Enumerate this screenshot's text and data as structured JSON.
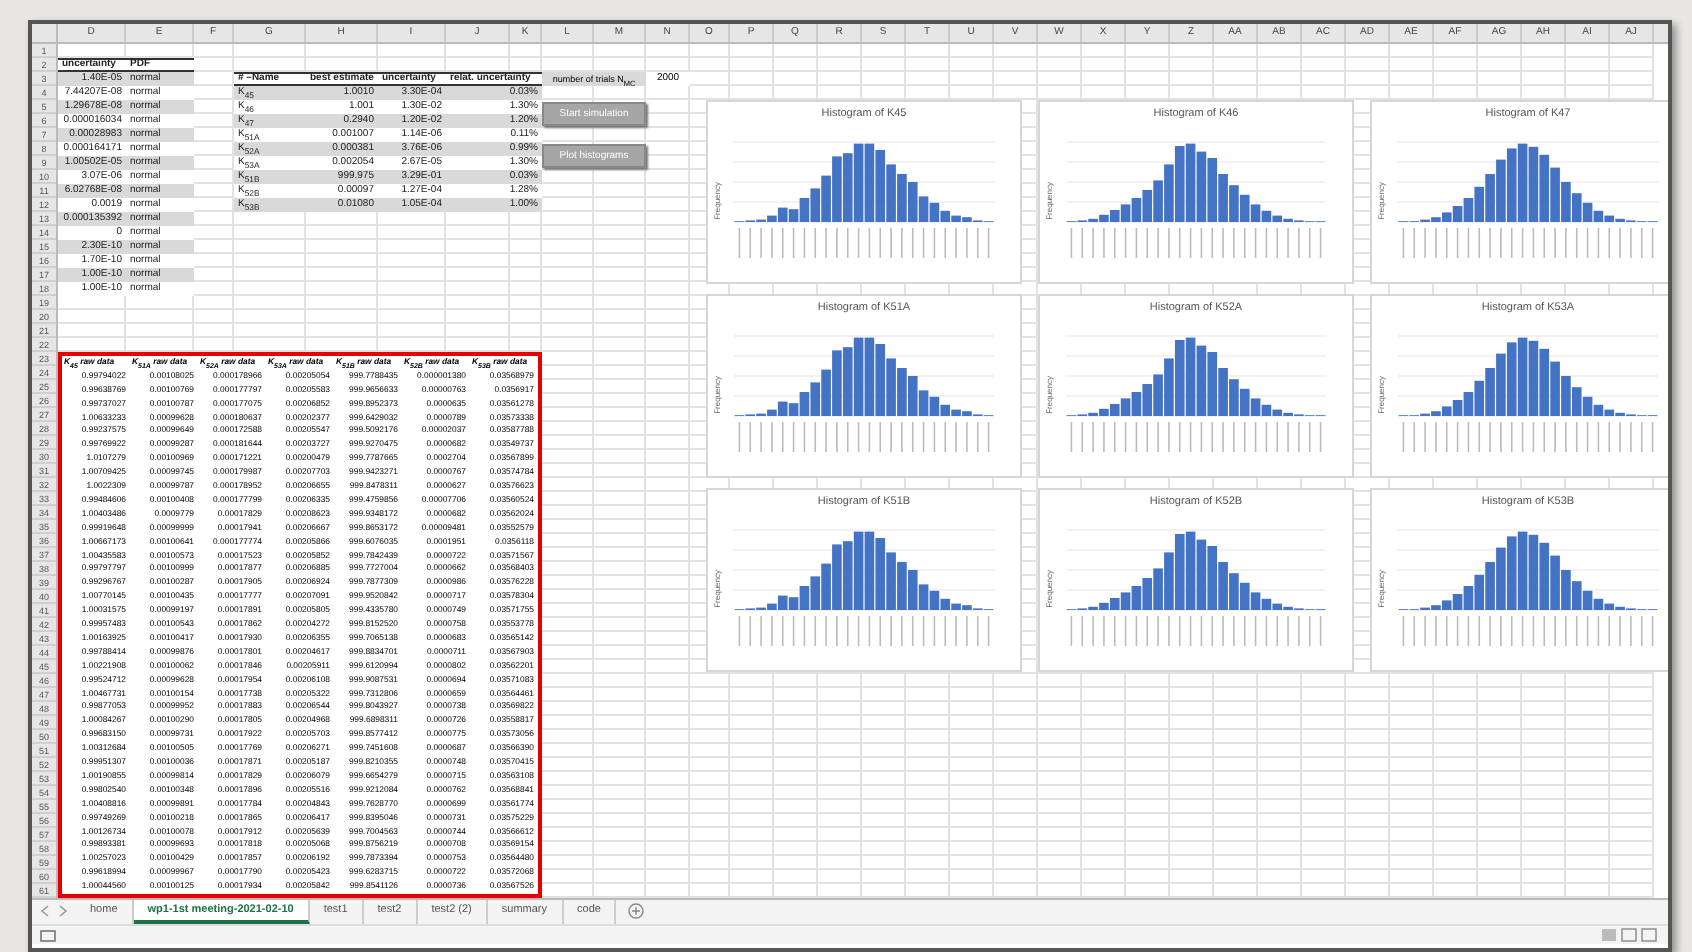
{
  "columns": [
    "D",
    "E",
    "F",
    "G",
    "H",
    "I",
    "J",
    "K",
    "L",
    "M",
    "N",
    "O",
    "P",
    "Q",
    "R",
    "S",
    "T",
    "U",
    "V",
    "W",
    "X",
    "Y",
    "Z",
    "AA",
    "AB",
    "AC",
    "AD",
    "AE",
    "AF",
    "AG",
    "AH",
    "AI",
    "AJ"
  ],
  "row_numbers": [
    "1",
    "2",
    "3",
    "4",
    "5",
    "6",
    "7",
    "8",
    "9",
    "10",
    "11",
    "12",
    "13",
    "14",
    "15",
    "16",
    "17",
    "18",
    "19",
    "20",
    "21",
    "22",
    "23",
    "24",
    "25",
    "26",
    "27",
    "28",
    "29",
    "30",
    "31",
    "32",
    "33",
    "34",
    "35",
    "36",
    "37",
    "38",
    "39",
    "40",
    "41",
    "42",
    "43",
    "44",
    "45",
    "46",
    "47",
    "48",
    "49",
    "50",
    "51",
    "52",
    "53",
    "54",
    "55",
    "56",
    "57",
    "58",
    "59",
    "60",
    "61"
  ],
  "uncertainty_table": {
    "headers": [
      "uncertainty",
      "PDF"
    ],
    "rows": [
      [
        "1.40E-05",
        "normal"
      ],
      [
        "7.44207E-08",
        "normal"
      ],
      [
        "1.29678E-08",
        "normal"
      ],
      [
        "0.000016034",
        "normal"
      ],
      [
        "0.00028983",
        "normal"
      ],
      [
        "0.000164171",
        "normal"
      ],
      [
        "1.00502E-05",
        "normal"
      ],
      [
        "3.07E-06",
        "normal"
      ],
      [
        "6.02768E-08",
        "normal"
      ],
      [
        "0.0019",
        "normal"
      ],
      [
        "0.000135392",
        "normal"
      ],
      [
        "0",
        "normal"
      ],
      [
        "2.30E-10",
        "normal"
      ],
      [
        "1.70E-10",
        "normal"
      ],
      [
        "1.00E-10",
        "normal"
      ],
      [
        "1.00E-10",
        "normal"
      ]
    ]
  },
  "estimates_table": {
    "headers": [
      "# –Name",
      "best estimate",
      "uncertainty",
      "relat. uncertainty"
    ],
    "rows": [
      [
        "K$_{45}$",
        "1.0010",
        "3.30E-04",
        "0.03%"
      ],
      [
        "K$_{46}$",
        "1.001",
        "1.30E-02",
        "1.30%"
      ],
      [
        "K$_{47}$",
        "0.2940",
        "1.20E-02",
        "1.20%"
      ],
      [
        "K$_{51A}$",
        "0.001007",
        "1.14E-06",
        "0.11%"
      ],
      [
        "K$_{52A}$",
        "0.000381",
        "3.76E-06",
        "0.99%"
      ],
      [
        "K$_{53A}$",
        "0.002054",
        "2.67E-05",
        "1.30%"
      ],
      [
        "K$_{51B}$",
        "999.975",
        "3.29E-01",
        "0.03%"
      ],
      [
        "K$_{52B}$",
        "0.00097",
        "1.27E-04",
        "1.28%"
      ],
      [
        "K$_{53B}$",
        "0.01080",
        "1.05E-04",
        "1.00%"
      ]
    ]
  },
  "trials": {
    "label": "number of trials N$_{MC}$",
    "value": "2000"
  },
  "buttons": [
    "Start simulation",
    "Plot histograms"
  ],
  "raw_data": {
    "headers": [
      "K$_{45}$ raw data",
      "K$_{51A}$ raw data",
      "K$_{52A}$ raw data",
      "K$_{53A}$ raw data",
      "K$_{51B}$ raw data",
      "K$_{52B}$ raw data",
      "K$_{53B}$ raw data"
    ],
    "rows": [
      [
        "0.99794022",
        "0.00108025",
        "0.000178966",
        "0.00205054",
        "999.7788435",
        "0.000001380",
        "0.03568979"
      ],
      [
        "0.99638769",
        "0.00100769",
        "0.000177797",
        "0.00205583",
        "999.9656633",
        "0.00000763",
        "0.0356917"
      ],
      [
        "0.99737027",
        "0.00100787",
        "0.000177075",
        "0.00206852",
        "999.8952373",
        "0.0000635",
        "0.03561278"
      ],
      [
        "1.00633233",
        "0.00099628",
        "0.000180637",
        "0.00202377",
        "999.6429032",
        "0.0000789",
        "0.03573338"
      ],
      [
        "0.99237575",
        "0.00099649",
        "0.000172588",
        "0.00205547",
        "999.5092176",
        "0.00002037",
        "0.03587788"
      ],
      [
        "0.99769922",
        "0.00099287",
        "0.000181644",
        "0.00203727",
        "999.9270475",
        "0.0000682",
        "0.03549737"
      ],
      [
        "1.0107279",
        "0.00100969",
        "0.000171221",
        "0.00200479",
        "999.7787665",
        "0.0002704",
        "0.03567899"
      ],
      [
        "1.00709425",
        "0.00099745",
        "0.000179987",
        "0.00207703",
        "999.9423271",
        "0.0000767",
        "0.03574784"
      ],
      [
        "1.0022309",
        "0.00099787",
        "0.000178952",
        "0.00206655",
        "999.8478311",
        "0.0000627",
        "0.03576623"
      ],
      [
        "0.99484606",
        "0.00100408",
        "0.000177799",
        "0.00206335",
        "999.4759856",
        "0.00007706",
        "0.03560524"
      ],
      [
        "1.00403486",
        "0.0009779",
        "0.00017829",
        "0.00208623",
        "999.9348172",
        "0.0000682",
        "0.03562024"
      ],
      [
        "0.99919648",
        "0.00099999",
        "0.00017941",
        "0.00206667",
        "999.8653172",
        "0.00009481",
        "0.03552579"
      ],
      [
        "1.00667173",
        "0.00100641",
        "0.000177774",
        "0.00205866",
        "999.6076035",
        "0.0001951",
        "0.0356118"
      ],
      [
        "1.00435583",
        "0.00100573",
        "0.00017523",
        "0.00205852",
        "999.7842439",
        "0.0000722",
        "0.03571567"
      ],
      [
        "0.99797797",
        "0.00100999",
        "0.00017877",
        "0.00206885",
        "999.7727004",
        "0.0000662",
        "0.03568403"
      ],
      [
        "0.99296767",
        "0.00100287",
        "0.00017905",
        "0.00206924",
        "999.7877309",
        "0.0000986",
        "0.03576228"
      ],
      [
        "1.00770145",
        "0.00100435",
        "0.00017777",
        "0.00207091",
        "999.9520842",
        "0.0000717",
        "0.03578304"
      ],
      [
        "1.00031575",
        "0.00099197",
        "0.00017891",
        "0.00205805",
        "999.4335780",
        "0.0000749",
        "0.03571755"
      ],
      [
        "0.99957483",
        "0.00100543",
        "0.00017862",
        "0.00204272",
        "999.8152520",
        "0.0000758",
        "0.03553778"
      ],
      [
        "1.00163925",
        "0.00100417",
        "0.00017930",
        "0.00206355",
        "999.7065138",
        "0.0000683",
        "0.03565142"
      ],
      [
        "0.99788414",
        "0.00099876",
        "0.00017801",
        "0.00204617",
        "999.8834701",
        "0.0000711",
        "0.03567903"
      ],
      [
        "1.00221908",
        "0.00100062",
        "0.00017846",
        "0.00205911",
        "999.6120994",
        "0.0000802",
        "0.03562201"
      ],
      [
        "0.99524712",
        "0.00099628",
        "0.00017954",
        "0.00206108",
        "999.9087531",
        "0.0000694",
        "0.03571083"
      ],
      [
        "1.00467731",
        "0.00100154",
        "0.00017738",
        "0.00205322",
        "999.7312806",
        "0.0000659",
        "0.03564461"
      ],
      [
        "0.99877053",
        "0.00099952",
        "0.00017883",
        "0.00206544",
        "999.8043927",
        "0.0000738",
        "0.03569822"
      ],
      [
        "1.00084267",
        "0.00100290",
        "0.00017805",
        "0.00204968",
        "999.6898311",
        "0.0000726",
        "0.03558817"
      ],
      [
        "0.99683150",
        "0.00099731",
        "0.00017922",
        "0.00205703",
        "999.8577412",
        "0.0000775",
        "0.03573056"
      ],
      [
        "1.00312684",
        "0.00100505",
        "0.00017769",
        "0.00206271",
        "999.7451608",
        "0.0000687",
        "0.03566390"
      ],
      [
        "0.99951307",
        "0.00100036",
        "0.00017871",
        "0.00205187",
        "999.8210355",
        "0.0000748",
        "0.03570415"
      ],
      [
        "1.00190855",
        "0.00099814",
        "0.00017829",
        "0.00206079",
        "999.6654279",
        "0.0000715",
        "0.03563108"
      ],
      [
        "0.99802540",
        "0.00100348",
        "0.00017896",
        "0.00205516",
        "999.9212084",
        "0.0000762",
        "0.03568841"
      ],
      [
        "1.00408816",
        "0.00099891",
        "0.00017784",
        "0.00204843",
        "999.7628770",
        "0.0000699",
        "0.03561774"
      ],
      [
        "0.99749269",
        "0.00100218",
        "0.00017865",
        "0.00206417",
        "999.8395046",
        "0.0000731",
        "0.03575229"
      ],
      [
        "1.00126734",
        "0.00100078",
        "0.00017912",
        "0.00205639",
        "999.7004563",
        "0.0000744",
        "0.03566612"
      ],
      [
        "0.99893381",
        "0.00099693",
        "0.00017818",
        "0.00205068",
        "999.8756219",
        "0.0000708",
        "0.03569154"
      ],
      [
        "1.00257023",
        "0.00100429",
        "0.00017857",
        "0.00206192",
        "999.7873394",
        "0.0000753",
        "0.03564480"
      ],
      [
        "0.99618994",
        "0.00099967",
        "0.00017790",
        "0.00205423",
        "999.6283715",
        "0.0000722",
        "0.03572068"
      ],
      [
        "1.00044560",
        "0.00100125",
        "0.00017934",
        "0.00205842",
        "999.8541126",
        "0.0000736",
        "0.03567526"
      ]
    ]
  },
  "histograms": [
    {
      "title": "Histogram of K45",
      "ylabel": "Frequency"
    },
    {
      "title": "Histogram of K46",
      "ylabel": "Frequency"
    },
    {
      "title": "Histogram of K47",
      "ylabel": "Frequency"
    },
    {
      "title": "Histogram of K51A",
      "ylabel": "Frequency"
    },
    {
      "title": "Histogram of K52A",
      "ylabel": "Frequency"
    },
    {
      "title": "Histogram of K53A",
      "ylabel": "Frequency"
    },
    {
      "title": "Histogram of K51B",
      "ylabel": "Frequency"
    },
    {
      "title": "Histogram of K52B",
      "ylabel": "Frequency"
    },
    {
      "title": "Histogram of K53B",
      "ylabel": "Frequency"
    }
  ],
  "sheet_tabs": [
    {
      "label": "home",
      "selected": false
    },
    {
      "label": "wp1-1st meeting-2021-02-10",
      "selected": true
    },
    {
      "label": "test1",
      "selected": false
    },
    {
      "label": "test2",
      "selected": false
    },
    {
      "label": "test2 (2)",
      "selected": false
    },
    {
      "label": "summary",
      "selected": false
    },
    {
      "label": "code",
      "selected": false
    }
  ]
}
